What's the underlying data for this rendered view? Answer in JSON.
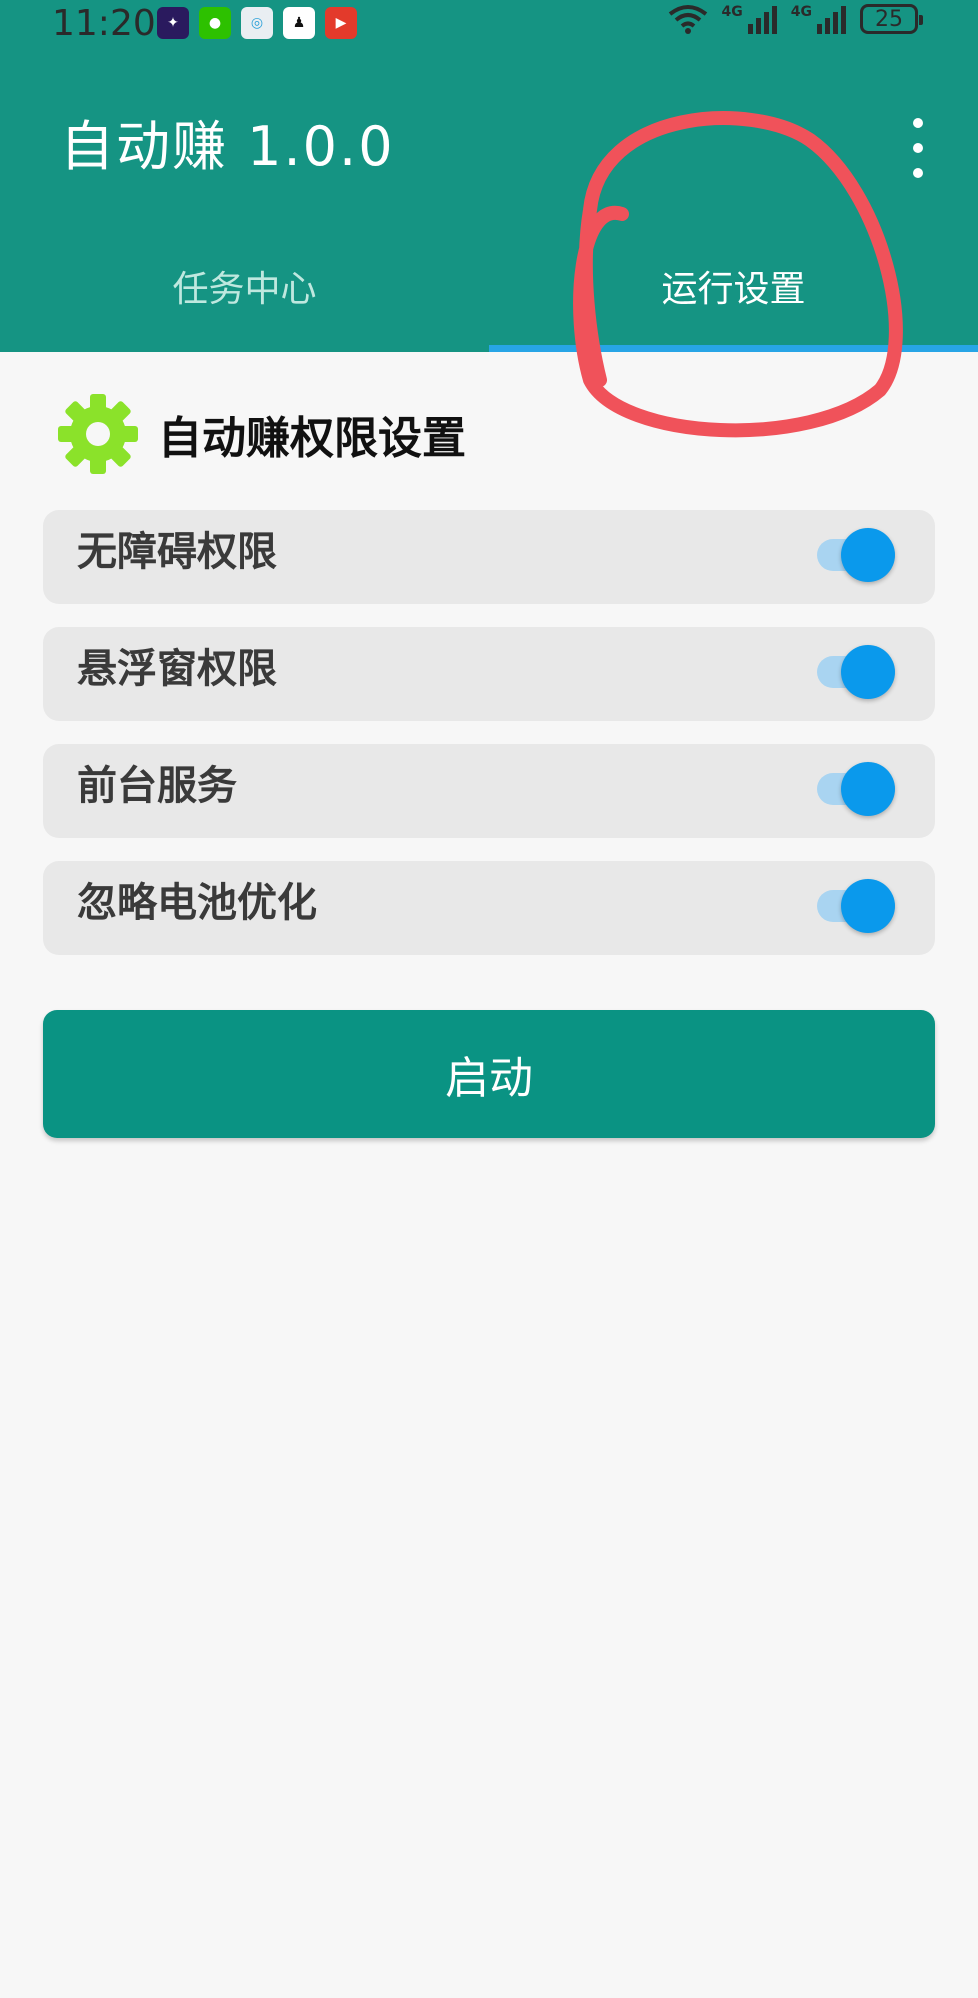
{
  "status_bar": {
    "time": "11:20",
    "notification_icons": [
      {
        "name": "app-icon",
        "color": "#2a1a5e"
      },
      {
        "name": "wechat-icon",
        "color": "#2dc100"
      },
      {
        "name": "search-app-icon",
        "color": "#e9eef2"
      },
      {
        "name": "qq-icon",
        "color": "#ffffff"
      },
      {
        "name": "video-app-icon",
        "color": "#e33a2b"
      }
    ],
    "net_labels": [
      "4G",
      "4G"
    ],
    "battery": "25"
  },
  "app_bar": {
    "title": "自动赚 1.0.0",
    "background": "#159483"
  },
  "tabs": [
    {
      "label": "任务中心",
      "active": false
    },
    {
      "label": "运行设置",
      "active": true
    }
  ],
  "section": {
    "title": "自动赚权限设置",
    "icon": "gear-icon",
    "icon_color": "#8be22a"
  },
  "permissions": [
    {
      "label": "无障碍权限",
      "enabled": true
    },
    {
      "label": "悬浮窗权限",
      "enabled": true
    },
    {
      "label": "前台服务",
      "enabled": true
    },
    {
      "label": "忽略电池优化",
      "enabled": true
    }
  ],
  "start_button": {
    "label": "启动"
  },
  "colors": {
    "accent": "#159483",
    "switch_on": "#0a99ec",
    "annotation": "#f0525a"
  }
}
